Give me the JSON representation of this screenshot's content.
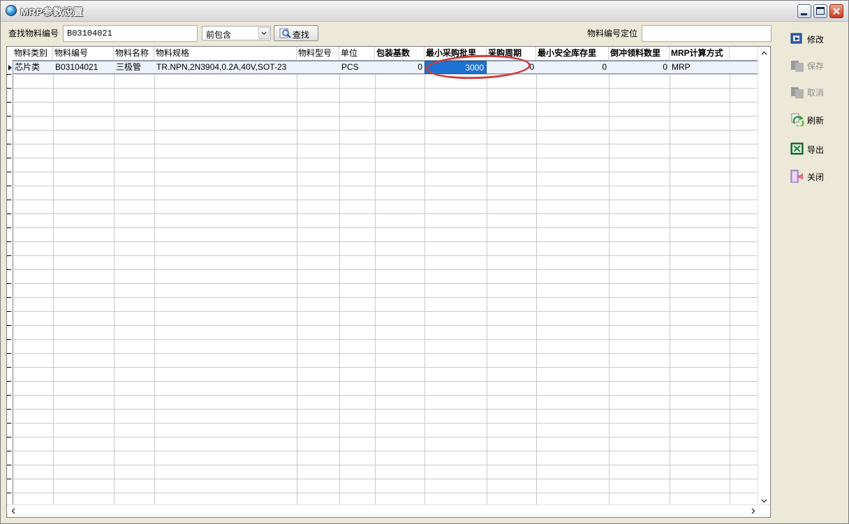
{
  "window": {
    "title": "MRP参数设置"
  },
  "search": {
    "label": "查找物料编号",
    "value": "B03104021",
    "mode": "前包含",
    "find_label": "查找",
    "locate_label": "物料编号定位",
    "locate_value": ""
  },
  "grid": {
    "columns": [
      {
        "label": "物料类别",
        "bold": false
      },
      {
        "label": "物料编号",
        "bold": false
      },
      {
        "label": "物料名称",
        "bold": false
      },
      {
        "label": "物料规格",
        "bold": false
      },
      {
        "label": "物料型号",
        "bold": false
      },
      {
        "label": "单位",
        "bold": false
      },
      {
        "label": "包装基数",
        "bold": true
      },
      {
        "label": "最小采购批里",
        "bold": true
      },
      {
        "label": "采购周期",
        "bold": true
      },
      {
        "label": "最小安全库存里",
        "bold": true
      },
      {
        "label": "倒冲领料数里",
        "bold": true
      },
      {
        "label": "MRP计算方式",
        "bold": true
      }
    ],
    "row": {
      "category": "芯片类",
      "code": "B03104021",
      "name": "三极管",
      "spec": "TR.NPN,2N3904,0.2A,40V,SOT-23",
      "model": "",
      "unit": "PCS",
      "pack_base": "0",
      "min_purchase_lot": "3000",
      "purchase_cycle": "0",
      "min_safety_stock": "0",
      "backflush_qty": "0",
      "mrp_method": "MRP"
    }
  },
  "toolbar": {
    "modify": "修改",
    "save": "保存",
    "cancel": "取消",
    "refresh": "刷新",
    "export": "导出",
    "close": "关闭"
  },
  "colors": {
    "edit_cell": "#1e73d2",
    "highlight_oval": "#d23b3b",
    "disabled_text": "#8c8c8c"
  }
}
